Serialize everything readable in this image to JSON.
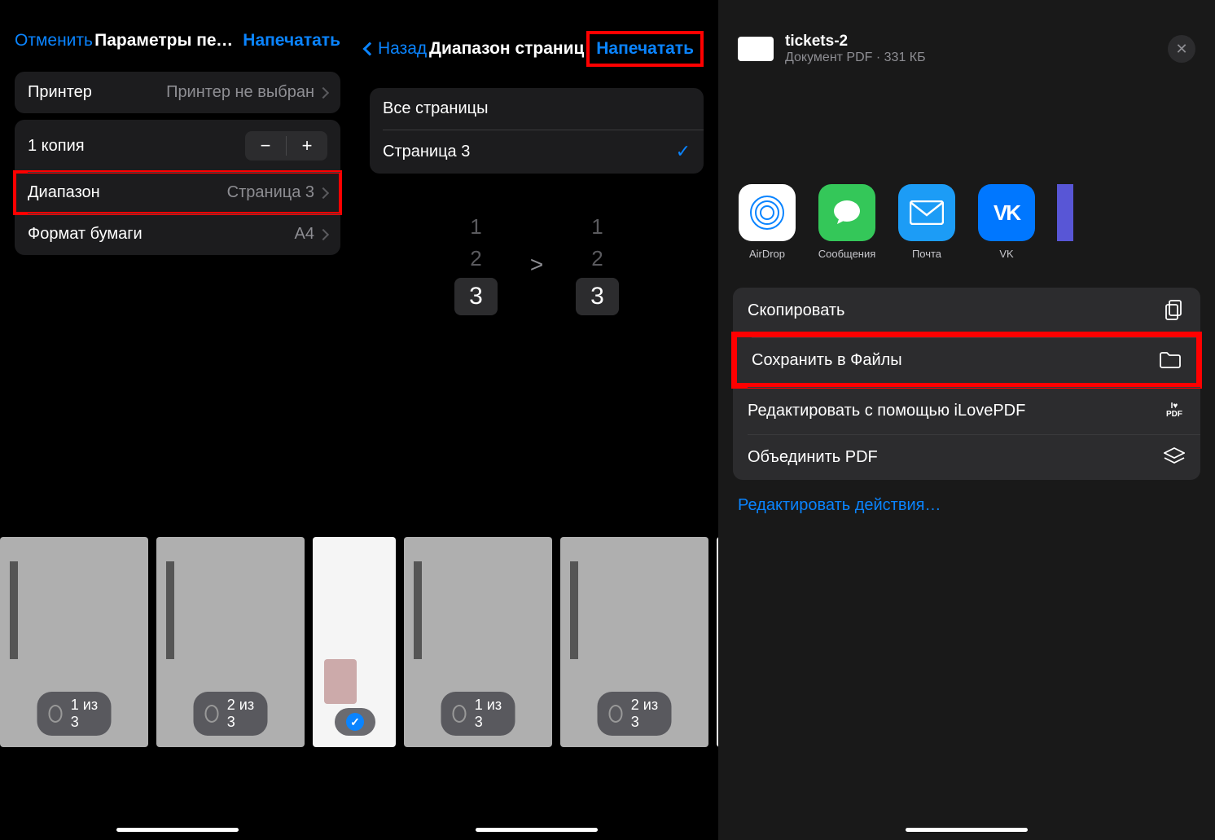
{
  "panel1": {
    "nav": {
      "cancel": "Отменить",
      "title": "Параметры печ…",
      "print": "Напечатать"
    },
    "printerRow": {
      "label": "Принтер",
      "value": "Принтер не выбран"
    },
    "copies": {
      "label": "1 копия"
    },
    "rangeRow": {
      "label": "Диапазон",
      "value": "Страница 3"
    },
    "paperRow": {
      "label": "Формат бумаги",
      "value": "A4"
    },
    "thumbs": [
      "1 из 3",
      "2 из 3"
    ]
  },
  "panel2": {
    "nav": {
      "back": "Назад",
      "title": "Диапазон страниц",
      "print": "Напечатать"
    },
    "allPages": "Все страницы",
    "page3": "Страница 3",
    "picker": {
      "colA": [
        "1",
        "2",
        "3"
      ],
      "mid": ">",
      "colB": [
        "1",
        "2",
        "3"
      ]
    },
    "thumbs": [
      "1 из 3",
      "2 из 3"
    ]
  },
  "panel3": {
    "file": {
      "name": "tickets-2",
      "sub": "Документ PDF · 331 КБ"
    },
    "apps": [
      {
        "id": "airdrop",
        "label": "AirDrop"
      },
      {
        "id": "messages",
        "label": "Сообщения"
      },
      {
        "id": "mail",
        "label": "Почта"
      },
      {
        "id": "vk",
        "label": "VK"
      }
    ],
    "actions": {
      "copy": "Скопировать",
      "saveFiles": "Сохранить в Файлы",
      "ilovepdf": "Редактировать с помощью iLovePDF",
      "merge": "Объединить PDF"
    },
    "editActions": "Редактировать действия…"
  }
}
